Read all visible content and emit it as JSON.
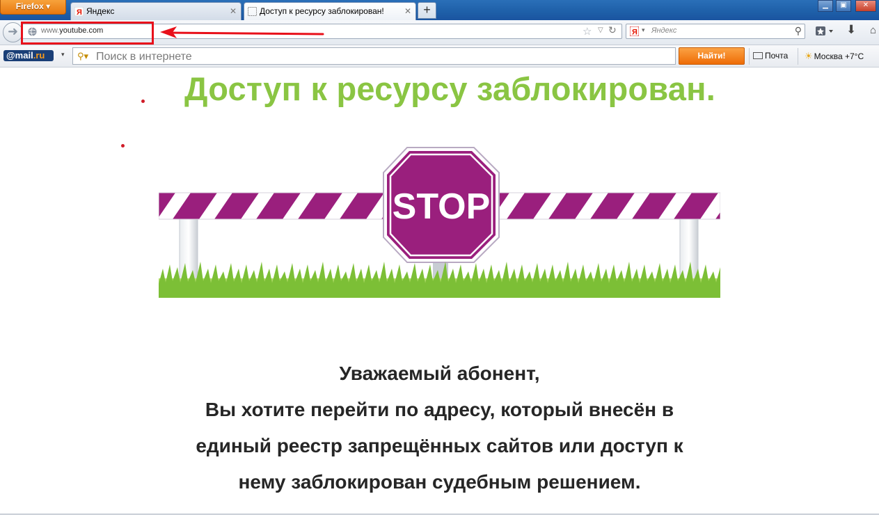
{
  "browser": {
    "app_button": "Firefox",
    "tabs": [
      {
        "label": "Яндекс",
        "active": false
      },
      {
        "label": "Доступ к ресурсу заблокирован!",
        "active": true
      }
    ],
    "newtab_label": "+",
    "url": {
      "prefix": "www.",
      "host": "youtube.com"
    },
    "search_placeholder": "Яндекс"
  },
  "mailru_toolbar": {
    "logo_at": "@mail",
    "logo_ru": ".ru",
    "search_placeholder": "Поиск в интернете",
    "find_button": "Найти!",
    "mail_link": "Почта",
    "weather_link": "Москва +7°C"
  },
  "page": {
    "title": "Доступ к ресурсу заблокирован.",
    "stop_sign_text": "STOP",
    "message_lines": [
      "Уважаемый абонент,",
      "Вы хотите перейти по адресу, который внесён в",
      "единый реестр запрещённых сайтов или доступ к",
      "нему заблокирован судебным решением."
    ]
  },
  "colors": {
    "title_green": "#8ac543",
    "stop_purple": "#9a1f7d",
    "annotation_red": "#e8101a",
    "find_orange": "#f28416"
  }
}
